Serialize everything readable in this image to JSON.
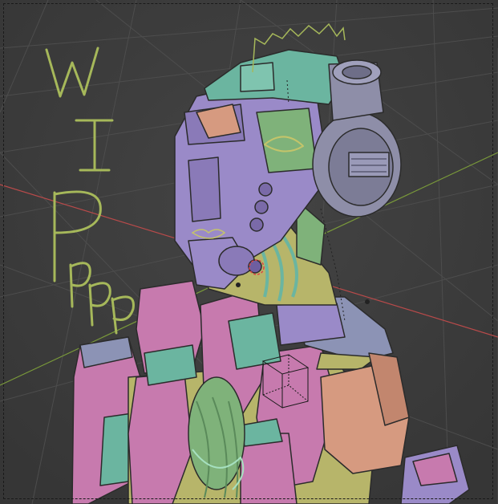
{
  "viewport": {
    "annotation_text": "WIPppp",
    "colors": {
      "background": "#3d3d3d",
      "grid": "#4a4a4a",
      "x_axis": "#b84a4a",
      "y_axis": "#7a9a3a",
      "annotation": "#a6b85a",
      "lavender": "#9a8ac8",
      "teal": "#6bb5a0",
      "pink": "#c77aae",
      "olive": "#b7b56a",
      "peach": "#d69a80",
      "slate": "#8c93b5"
    }
  }
}
